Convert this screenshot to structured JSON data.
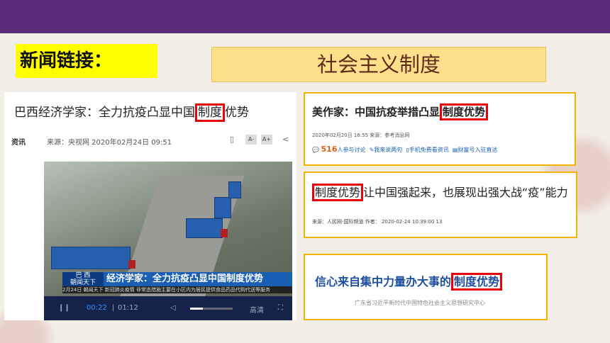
{
  "header": {
    "news_tag": "新闻链接：",
    "headline": "社会主义制度"
  },
  "left_article": {
    "title_pre": "巴西经济学家：全力抗疫凸显中国",
    "title_hl": "制度",
    "title_post": "优势",
    "source_tag": "资讯",
    "source_info": "来源：央视网 2020年02月24日 09:51",
    "font_small": "A-",
    "font_large": "A+",
    "video": {
      "caption_tag_top": "巴 西",
      "caption_tag_bottom": "朝闻天下",
      "caption_main": "经济学家：全力抗疫凸显中国制度优势",
      "ticker": "2月24日 朝闻天下  新冠肺炎疫情  非常态措施主要在小区内为居民提供食品药品代购代送等服务",
      "time_current": "00:22",
      "time_total": "01:12",
      "quality": "高清",
      "progress": 0.3
    }
  },
  "card1": {
    "title_pre": "美作家：中国抗疫举措凸显",
    "title_hl": "制度优势",
    "date": "2020年02月20日 16:55  来源：参考消息网",
    "count": "516",
    "count_label": "人参与讨论",
    "act2": "我来说两句",
    "act3": "手机免费看资讯",
    "act4": "财富号入驻直达"
  },
  "card2": {
    "title_hl": "制度优势",
    "title_post": "让中国强起来，也展现出强大战“疫”能力",
    "meta": "来源：人民网-国际频道    作者：        2020-02-24 10:39:00 13"
  },
  "card3": {
    "title_pre": "信心来自集中力量办大事的",
    "title_hl": "制度优势",
    "meta": "广东省习近平新时代中国特色社会主义思想研究中心"
  }
}
